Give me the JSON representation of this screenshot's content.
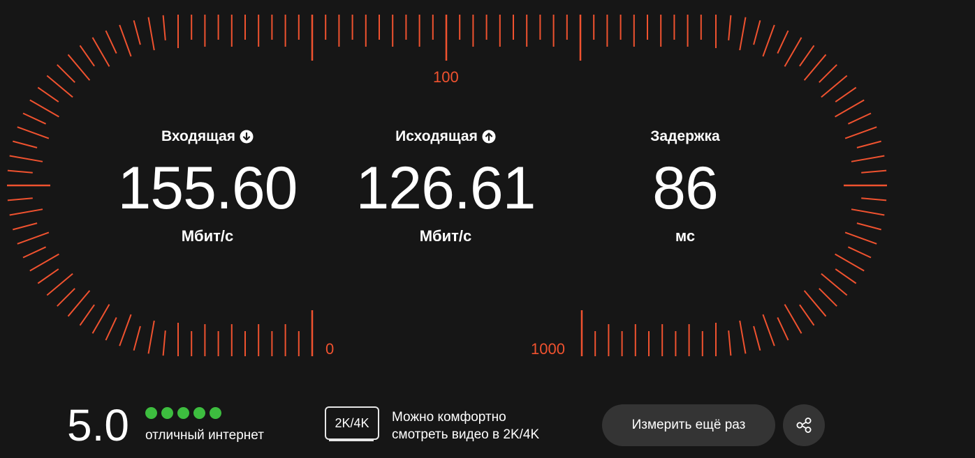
{
  "gauge": {
    "scale_labels": {
      "top": "100",
      "bottom_left": "0",
      "bottom_right": "1000"
    },
    "tick_color": "#f0522f"
  },
  "metrics": {
    "download": {
      "label": "Входящая",
      "value": "155.60",
      "unit": "Мбит/с",
      "icon": "arrow-down-circle-icon"
    },
    "upload": {
      "label": "Исходящая",
      "value": "126.61",
      "unit": "Мбит/с",
      "icon": "arrow-up-circle-icon"
    },
    "latency": {
      "label": "Задержка",
      "value": "86",
      "unit": "мс"
    }
  },
  "rating": {
    "score": "5.0",
    "stars_filled": 5,
    "stars_total": 5,
    "description": "отличный интернет",
    "dot_color": "#3dbd3f"
  },
  "video": {
    "badge": "2K/4K",
    "line1": "Можно комфортно",
    "line2": "смотреть видео в 2K/4K"
  },
  "actions": {
    "retry_label": "Измерить ещё раз",
    "share_icon": "share-icon"
  },
  "colors": {
    "background": "#161616",
    "accent": "#f0522f",
    "button_bg": "#343434"
  }
}
